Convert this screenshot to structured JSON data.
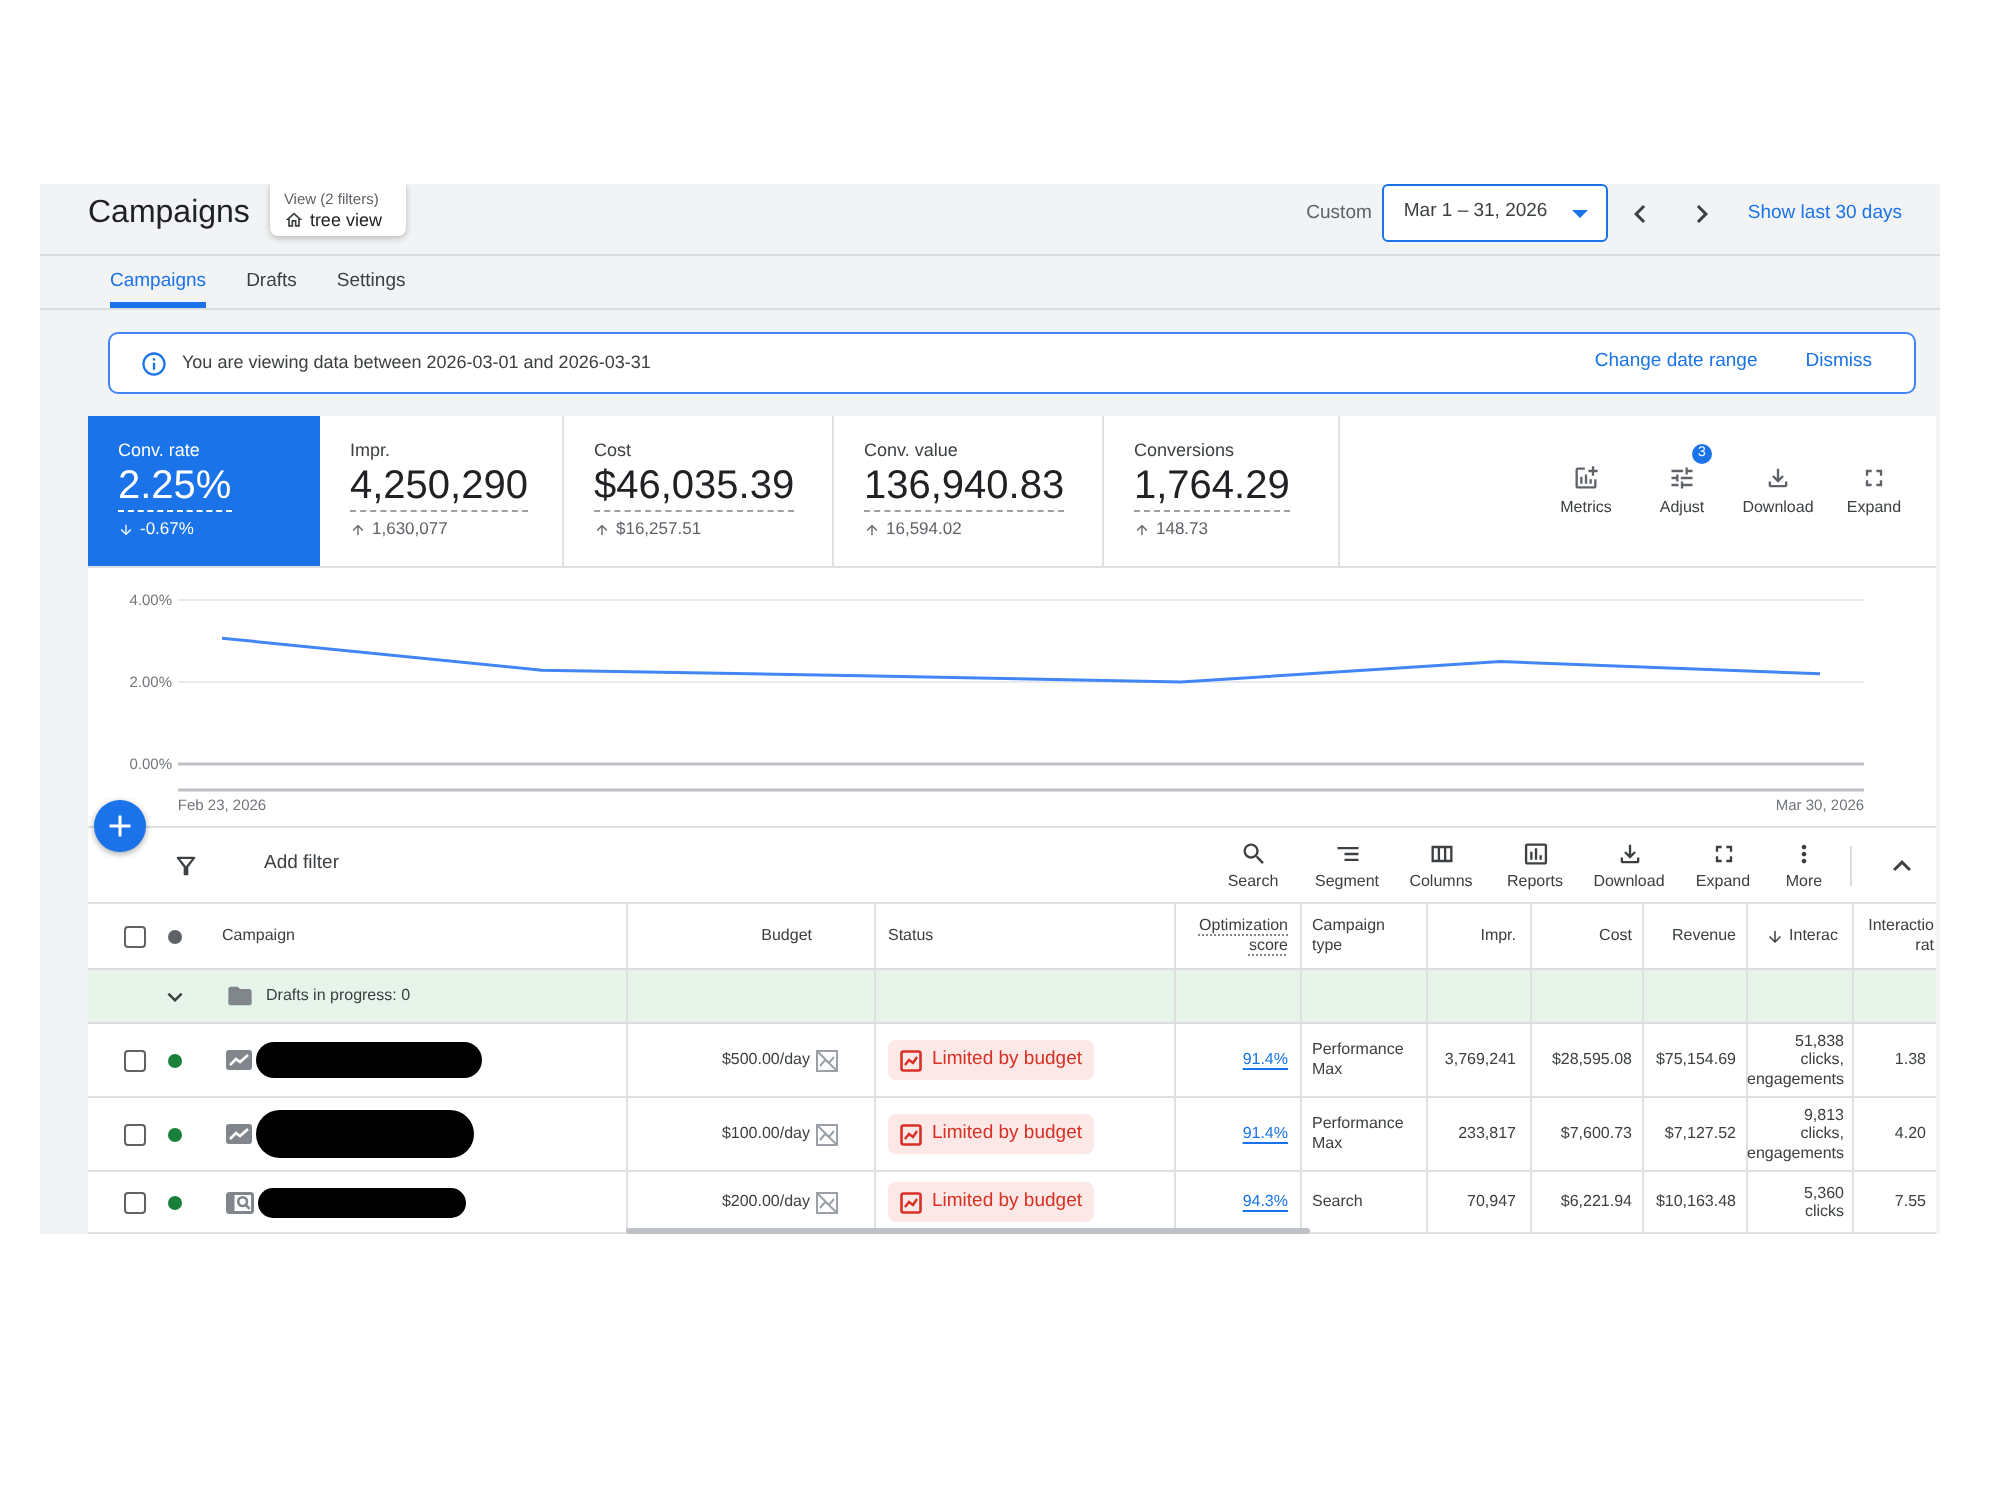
{
  "header": {
    "title": "Campaigns",
    "view": {
      "label": "View (2 filters)",
      "value": "tree view"
    },
    "date_label": "Custom",
    "date_range": "Mar 1 – 31, 2026",
    "quick_link": "Show last 30 days"
  },
  "tabs": [
    {
      "label": "Campaigns",
      "selected": true
    },
    {
      "label": "Drafts",
      "selected": false
    },
    {
      "label": "Settings",
      "selected": false
    }
  ],
  "banner": {
    "message": "You are viewing data between 2026-03-01 and 2026-03-31",
    "actions": [
      "Change date range",
      "Dismiss"
    ]
  },
  "metrics": [
    {
      "label": "Conv. rate",
      "value": "2.25%",
      "change": "-0.67%",
      "increase": false,
      "selected": true
    },
    {
      "label": "Impr.",
      "value": "4,250,290",
      "change": "1,630,077",
      "increase": true,
      "selected": false
    },
    {
      "label": "Cost",
      "value": "$46,035.39",
      "change": "$16,257.51",
      "increase": true,
      "selected": false
    },
    {
      "label": "Conv. value",
      "value": "136,940.83",
      "change": "16,594.02",
      "increase": true,
      "selected": false
    },
    {
      "label": "Conversions",
      "value": "1,764.29",
      "change": "148.73",
      "increase": true,
      "selected": false
    }
  ],
  "metric_actions": [
    {
      "label": "Metrics"
    },
    {
      "label": "Adjust",
      "count": "3"
    },
    {
      "label": "Download"
    },
    {
      "label": "Expand"
    }
  ],
  "chart": {
    "chart_data": {
      "type": "line",
      "categories": [
        "Feb 23, 2026",
        null,
        null,
        null,
        null,
        "Mar 30, 2026"
      ],
      "values": [
        3.07,
        2.29,
        2.15,
        2.0,
        2.5,
        2.2
      ],
      "ylim": [
        0,
        4
      ],
      "yticks": [
        {
          "value": 0,
          "label": "0.00%"
        },
        {
          "value": 2,
          "label": "2.00%"
        },
        {
          "value": 4,
          "label": "4.00%"
        }
      ]
    }
  },
  "toolbar": {
    "filter": "Add filter",
    "actions": [
      "Search",
      "Segment",
      "Columns",
      "Reports",
      "Download",
      "Expand",
      "More"
    ]
  },
  "table": {
    "select_all": {
      "checked": false
    },
    "columns": [
      {
        "label": "Campaign",
        "sorted": false
      },
      {
        "label": "Budget",
        "sorted": false
      },
      {
        "label": "Status",
        "sorted": false
      },
      {
        "label": "Optimization score",
        "sorted": false
      },
      {
        "label": "Campaign type",
        "sorted": false
      },
      {
        "label": "Impr.",
        "sorted": false
      },
      {
        "label": "Cost",
        "sorted": false
      },
      {
        "label": "Revenue",
        "sorted": false
      },
      {
        "label": "Interac",
        "sorted": true
      },
      {
        "label": "Interactio rat",
        "sorted": false
      }
    ],
    "group_row": {
      "label": "Drafts in progress: 0",
      "expanded": true
    },
    "rows": [
      {
        "checked": false,
        "enabled": true,
        "kind": "performance_max",
        "budget": "$500.00/day",
        "status": "Limited by budget",
        "optimization_score": "91.4%",
        "campaign_type": "Performance Max",
        "impr": "3,769,241",
        "cost": "$28,595.08",
        "revenue": "$75,154.69",
        "interactions": "51,838 clicks, engagements",
        "interaction_rate": "1.38"
      },
      {
        "checked": false,
        "enabled": true,
        "kind": "performance_max",
        "budget": "$100.00/day",
        "status": "Limited by budget",
        "optimization_score": "91.4%",
        "campaign_type": "Performance Max",
        "impr": "233,817",
        "cost": "$7,600.73",
        "revenue": "$7,127.52",
        "interactions": "9,813 clicks, engagements",
        "interaction_rate": "4.20"
      },
      {
        "checked": false,
        "enabled": true,
        "kind": "search",
        "budget": "$200.00/day",
        "status": "Limited by budget",
        "optimization_score": "94.3%",
        "campaign_type": "Search",
        "impr": "70,947",
        "cost": "$6,221.94",
        "revenue": "$10,163.48",
        "interactions": "5,360 clicks",
        "interaction_rate": "7.55"
      }
    ]
  }
}
